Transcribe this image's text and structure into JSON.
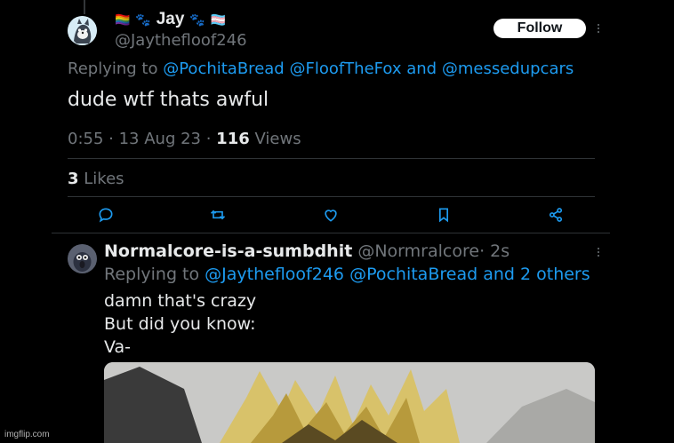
{
  "tweet": {
    "display_name": "Jay",
    "name_decorations": [
      "🏳️‍🌈",
      "🐾",
      "🐾",
      "🏳️‍⚧️"
    ],
    "handle": "@Jaythefloof246",
    "follow_label": "Follow",
    "replying_to_label": "Replying to",
    "replying_to": [
      "@PochitaBread",
      "@FloofTheFox"
    ],
    "replying_to_and": "and",
    "replying_to_last": "@messedupcars",
    "text": "dude wtf thats awful",
    "time": "0:55",
    "date": "13 Aug 23",
    "views_count": "116",
    "views_label": "Views",
    "likes_count": "3",
    "likes_label": "Likes",
    "actions": [
      "reply-icon",
      "retweet-icon",
      "like-icon",
      "bookmark-icon",
      "share-icon"
    ]
  },
  "reply": {
    "display_name": "Normalcore-is-a-sumbdhit",
    "handle": "@Normralcore",
    "time_ago": "2s",
    "replying_to_label": "Replying to",
    "replying_to": [
      "@Jaythefloof246",
      "@PochitaBread"
    ],
    "replying_to_rest": "and 2 others",
    "lines": [
      "damn that's crazy",
      "But did you know:",
      "Va-"
    ]
  },
  "watermark": "imgflip.com",
  "colors": {
    "link": "#1d9bf0",
    "muted": "#71767b",
    "background": "#000000"
  }
}
